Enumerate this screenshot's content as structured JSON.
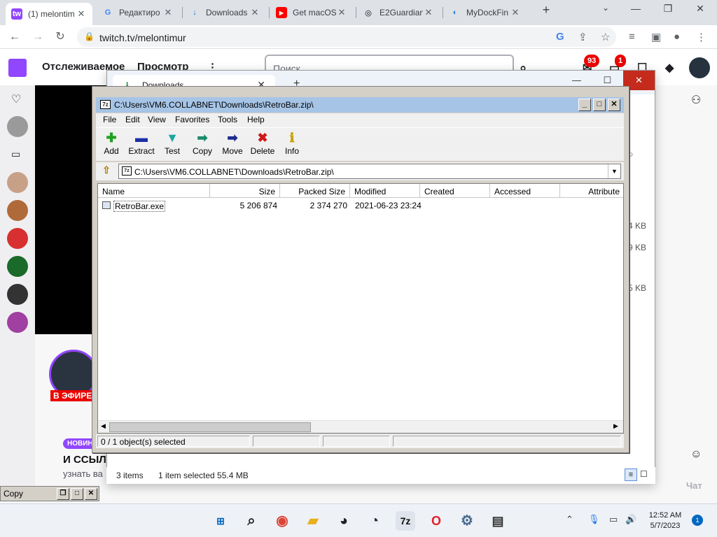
{
  "browser": {
    "tabs": [
      {
        "title": "(1) melontim",
        "favicon_text": "tw",
        "active": true
      },
      {
        "title": "Редактиро",
        "favicon_text": "G"
      },
      {
        "title": "Downloads",
        "favicon_text": "↓"
      },
      {
        "title": "Get macOS",
        "favicon_text": "▶"
      },
      {
        "title": "E2Guardian",
        "favicon_text": "◎"
      },
      {
        "title": "MyDockFin",
        "favicon_text": "◐"
      }
    ],
    "new_tab": "+",
    "url": "twitch.tv/melontimur",
    "window_controls": {
      "minimize": "—",
      "restore": "❐",
      "close": "✕"
    }
  },
  "twitch": {
    "nav": [
      "Отслеживаемое",
      "Просмотр"
    ],
    "more": "⋮",
    "search_placeholder": "Поиск",
    "badges": [
      "93",
      "1"
    ],
    "live_label": "В ЭФИРЕ",
    "new_tag": "НОВИН",
    "headline": "И ССЫЛ",
    "subline": "узнать ва",
    "chat_label": "Чат",
    "size_fragments": [
      "4 KB",
      "9 KB",
      "5 KB"
    ]
  },
  "explorer": {
    "tab_title": "Downloads",
    "new_tab": "+",
    "status": {
      "items": "3 items",
      "selected": "1 item selected  55.4 MB"
    }
  },
  "sevenzip": {
    "title": "C:\\Users\\VM6.COLLABNET\\Downloads\\RetroBar.zip\\",
    "icon": "7z",
    "menu": [
      "File",
      "Edit",
      "View",
      "Favorites",
      "Tools",
      "Help"
    ],
    "toolbar": [
      {
        "label": "Add",
        "glyph": "✚",
        "color": "#1fa01f"
      },
      {
        "label": "Extract",
        "glyph": "▬",
        "color": "#1c2fa8"
      },
      {
        "label": "Test",
        "glyph": "▼",
        "color": "#1aa6a0"
      },
      {
        "label": "Copy",
        "glyph": "➡",
        "color": "#1a8a6a"
      },
      {
        "label": "Move",
        "glyph": "➡",
        "color": "#1b2b8c"
      },
      {
        "label": "Delete",
        "glyph": "✖",
        "color": "#d01818"
      },
      {
        "label": "Info",
        "glyph": "ℹ",
        "color": "#c8a000"
      }
    ],
    "address": "C:\\Users\\VM6.COLLABNET\\Downloads\\RetroBar.zip\\",
    "columns": [
      "Name",
      "Size",
      "Packed Size",
      "Modified",
      "Created",
      "Accessed",
      "Attribute"
    ],
    "rows": [
      {
        "name": "RetroBar.exe",
        "size": "5 206 874",
        "packed": "2 374 270",
        "modified": "2021-06-23 23:24",
        "created": "",
        "accessed": "",
        "attributes": ""
      }
    ],
    "status": "0 / 1 object(s) selected"
  },
  "copy_window": {
    "title": "Copy"
  },
  "taskbar": {
    "apps": [
      {
        "name": "start",
        "glyph": "⊞",
        "color": "#0067c0"
      },
      {
        "name": "search",
        "glyph": "⌕",
        "color": "#222222"
      },
      {
        "name": "chrome",
        "glyph": "◉",
        "color": "#db4437"
      },
      {
        "name": "explorer",
        "glyph": "▰",
        "color": "#e8b020"
      },
      {
        "name": "obs",
        "glyph": "◕",
        "color": "#222222"
      },
      {
        "name": "steam",
        "glyph": "◔",
        "color": "#1b2838"
      },
      {
        "name": "7zip",
        "glyph": "7z",
        "color": "#111111"
      },
      {
        "name": "opera",
        "glyph": "O",
        "color": "#e0202a"
      },
      {
        "name": "settings",
        "glyph": "⚙",
        "color": "#4a6a90"
      },
      {
        "name": "remote",
        "glyph": "▤",
        "color": "#333333"
      }
    ],
    "time": "12:52 AM",
    "date": "5/7/2023",
    "notifications": "1"
  }
}
